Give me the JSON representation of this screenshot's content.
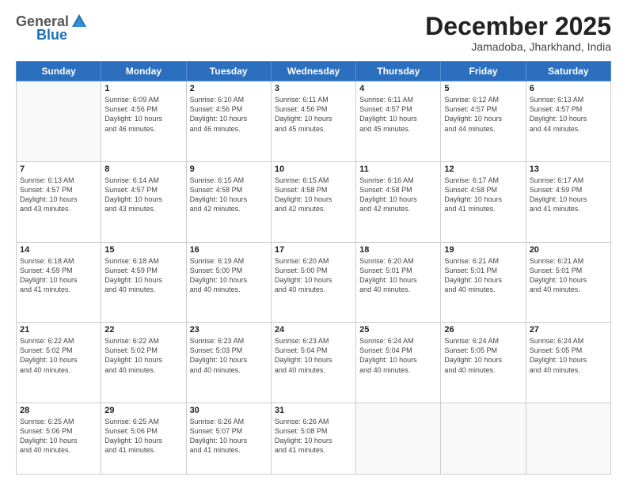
{
  "logo": {
    "general": "General",
    "blue": "Blue"
  },
  "header": {
    "month": "December 2025",
    "location": "Jamadoba, Jharkhand, India"
  },
  "weekdays": [
    "Sunday",
    "Monday",
    "Tuesday",
    "Wednesday",
    "Thursday",
    "Friday",
    "Saturday"
  ],
  "weeks": [
    [
      {
        "day": "",
        "info": ""
      },
      {
        "day": "1",
        "info": "Sunrise: 6:09 AM\nSunset: 4:56 PM\nDaylight: 10 hours\nand 46 minutes."
      },
      {
        "day": "2",
        "info": "Sunrise: 6:10 AM\nSunset: 4:56 PM\nDaylight: 10 hours\nand 46 minutes."
      },
      {
        "day": "3",
        "info": "Sunrise: 6:11 AM\nSunset: 4:56 PM\nDaylight: 10 hours\nand 45 minutes."
      },
      {
        "day": "4",
        "info": "Sunrise: 6:11 AM\nSunset: 4:57 PM\nDaylight: 10 hours\nand 45 minutes."
      },
      {
        "day": "5",
        "info": "Sunrise: 6:12 AM\nSunset: 4:57 PM\nDaylight: 10 hours\nand 44 minutes."
      },
      {
        "day": "6",
        "info": "Sunrise: 6:13 AM\nSunset: 4:57 PM\nDaylight: 10 hours\nand 44 minutes."
      }
    ],
    [
      {
        "day": "7",
        "info": "Sunrise: 6:13 AM\nSunset: 4:57 PM\nDaylight: 10 hours\nand 43 minutes."
      },
      {
        "day": "8",
        "info": "Sunrise: 6:14 AM\nSunset: 4:57 PM\nDaylight: 10 hours\nand 43 minutes."
      },
      {
        "day": "9",
        "info": "Sunrise: 6:15 AM\nSunset: 4:58 PM\nDaylight: 10 hours\nand 42 minutes."
      },
      {
        "day": "10",
        "info": "Sunrise: 6:15 AM\nSunset: 4:58 PM\nDaylight: 10 hours\nand 42 minutes."
      },
      {
        "day": "11",
        "info": "Sunrise: 6:16 AM\nSunset: 4:58 PM\nDaylight: 10 hours\nand 42 minutes."
      },
      {
        "day": "12",
        "info": "Sunrise: 6:17 AM\nSunset: 4:58 PM\nDaylight: 10 hours\nand 41 minutes."
      },
      {
        "day": "13",
        "info": "Sunrise: 6:17 AM\nSunset: 4:59 PM\nDaylight: 10 hours\nand 41 minutes."
      }
    ],
    [
      {
        "day": "14",
        "info": "Sunrise: 6:18 AM\nSunset: 4:59 PM\nDaylight: 10 hours\nand 41 minutes."
      },
      {
        "day": "15",
        "info": "Sunrise: 6:18 AM\nSunset: 4:59 PM\nDaylight: 10 hours\nand 40 minutes."
      },
      {
        "day": "16",
        "info": "Sunrise: 6:19 AM\nSunset: 5:00 PM\nDaylight: 10 hours\nand 40 minutes."
      },
      {
        "day": "17",
        "info": "Sunrise: 6:20 AM\nSunset: 5:00 PM\nDaylight: 10 hours\nand 40 minutes."
      },
      {
        "day": "18",
        "info": "Sunrise: 6:20 AM\nSunset: 5:01 PM\nDaylight: 10 hours\nand 40 minutes."
      },
      {
        "day": "19",
        "info": "Sunrise: 6:21 AM\nSunset: 5:01 PM\nDaylight: 10 hours\nand 40 minutes."
      },
      {
        "day": "20",
        "info": "Sunrise: 6:21 AM\nSunset: 5:01 PM\nDaylight: 10 hours\nand 40 minutes."
      }
    ],
    [
      {
        "day": "21",
        "info": "Sunrise: 6:22 AM\nSunset: 5:02 PM\nDaylight: 10 hours\nand 40 minutes."
      },
      {
        "day": "22",
        "info": "Sunrise: 6:22 AM\nSunset: 5:02 PM\nDaylight: 10 hours\nand 40 minutes."
      },
      {
        "day": "23",
        "info": "Sunrise: 6:23 AM\nSunset: 5:03 PM\nDaylight: 10 hours\nand 40 minutes."
      },
      {
        "day": "24",
        "info": "Sunrise: 6:23 AM\nSunset: 5:04 PM\nDaylight: 10 hours\nand 40 minutes."
      },
      {
        "day": "25",
        "info": "Sunrise: 6:24 AM\nSunset: 5:04 PM\nDaylight: 10 hours\nand 40 minutes."
      },
      {
        "day": "26",
        "info": "Sunrise: 6:24 AM\nSunset: 5:05 PM\nDaylight: 10 hours\nand 40 minutes."
      },
      {
        "day": "27",
        "info": "Sunrise: 6:24 AM\nSunset: 5:05 PM\nDaylight: 10 hours\nand 40 minutes."
      }
    ],
    [
      {
        "day": "28",
        "info": "Sunrise: 6:25 AM\nSunset: 5:06 PM\nDaylight: 10 hours\nand 40 minutes."
      },
      {
        "day": "29",
        "info": "Sunrise: 6:25 AM\nSunset: 5:06 PM\nDaylight: 10 hours\nand 41 minutes."
      },
      {
        "day": "30",
        "info": "Sunrise: 6:26 AM\nSunset: 5:07 PM\nDaylight: 10 hours\nand 41 minutes."
      },
      {
        "day": "31",
        "info": "Sunrise: 6:26 AM\nSunset: 5:08 PM\nDaylight: 10 hours\nand 41 minutes."
      },
      {
        "day": "",
        "info": ""
      },
      {
        "day": "",
        "info": ""
      },
      {
        "day": "",
        "info": ""
      }
    ]
  ]
}
